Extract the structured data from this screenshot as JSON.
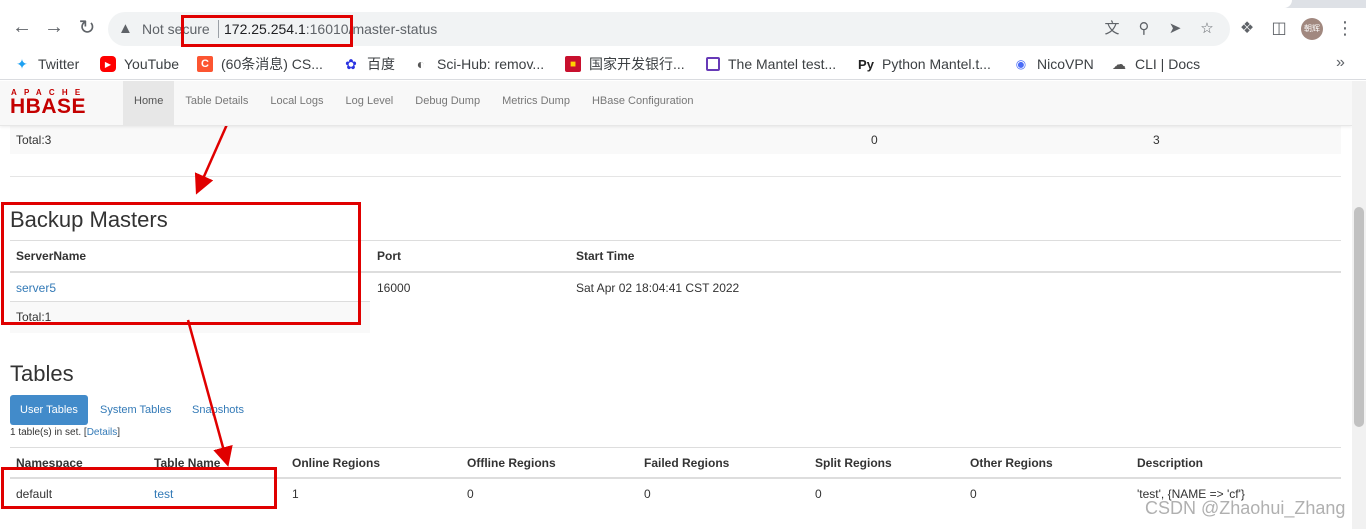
{
  "browser": {
    "not_secure": "Not secure",
    "url_host": "172.25.254.1",
    "url_rest": ":16010/master-status",
    "avatar_text": "朝辉",
    "bookmarks": [
      {
        "label": "Twitter",
        "icon": "twitter-icon"
      },
      {
        "label": "YouTube",
        "icon": "youtube-icon"
      },
      {
        "label": "(60条消息) CS...",
        "icon": "csdn-icon"
      },
      {
        "label": "百度",
        "icon": "baidu-icon"
      },
      {
        "label": "Sci-Hub: remov...",
        "icon": "globe-icon"
      },
      {
        "label": "国家开发银行...",
        "icon": "bank-icon"
      },
      {
        "label": "The Mantel test...",
        "icon": "page-icon"
      },
      {
        "label": "Python Mantel.t...",
        "icon": "python-icon"
      },
      {
        "label": "NicoVPN",
        "icon": "vpn-icon"
      },
      {
        "label": "CLI | Docs",
        "icon": "cloud-icon"
      }
    ]
  },
  "navbar": {
    "logo_top": "APACHE",
    "logo_main": "HBASE",
    "links": [
      "Home",
      "Table Details",
      "Local Logs",
      "Log Level",
      "Debug Dump",
      "Metrics Dump",
      "HBase Configuration"
    ]
  },
  "region_servers_total": {
    "label": "Total:3",
    "col2": "0",
    "col3": "3"
  },
  "backup_masters": {
    "title": "Backup Masters",
    "headers": [
      "ServerName",
      "Port",
      "Start Time"
    ],
    "rows": [
      [
        "server5",
        "16000",
        "Sat Apr 02 18:04:41 CST 2022"
      ]
    ],
    "total": "Total:1"
  },
  "tables": {
    "title": "Tables",
    "tabs": [
      "User Tables",
      "System Tables",
      "Snapshots"
    ],
    "count_text": "1 table(s) in set. [",
    "details_link": "Details",
    "count_close": "]",
    "headers": [
      "Namespace",
      "Table Name",
      "Online Regions",
      "Offline Regions",
      "Failed Regions",
      "Split Regions",
      "Other Regions",
      "Description"
    ],
    "rows": [
      [
        "default",
        "test",
        "1",
        "0",
        "0",
        "0",
        "0",
        "'test', {NAME => 'cf'}"
      ]
    ]
  },
  "watermark": "CSDN @Zhaohui_Zhang",
  "colors": {
    "accent": "#428bca",
    "link": "#337ab7",
    "annotation": "#e00000",
    "logo": "#c40000"
  }
}
